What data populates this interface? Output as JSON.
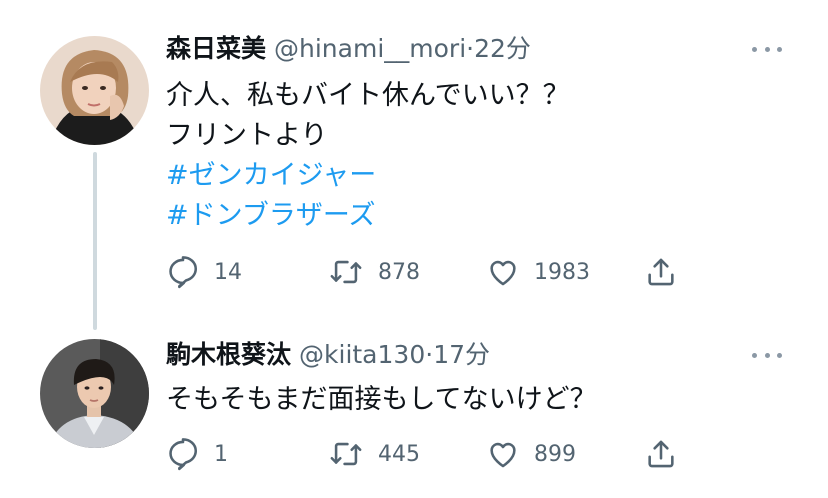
{
  "tweets": [
    {
      "name": "森日菜美",
      "handle": "@hinami__mori",
      "time": "22分",
      "lines": [
        "介人、私もバイト休んでいい？？",
        "フリントより"
      ],
      "hashtags": [
        "#ゼンカイジャー",
        "#ドンブラザーズ"
      ],
      "replies": "14",
      "retweets": "878",
      "likes": "1983"
    },
    {
      "name": "駒木根葵汰",
      "handle": "@kiita130",
      "time": "17分",
      "lines": [
        "そもそもまだ面接もしてないけど？"
      ],
      "hashtags": [],
      "replies": "1",
      "retweets": "445",
      "likes": "899"
    }
  ],
  "ui": {
    "separator": "·"
  },
  "colors": {
    "hashtag": "#1d9bf0",
    "secondary": "#536471",
    "thread": "#cfd9de"
  },
  "icons": [
    "reply-icon",
    "retweet-icon",
    "like-icon",
    "share-icon",
    "more-icon"
  ]
}
